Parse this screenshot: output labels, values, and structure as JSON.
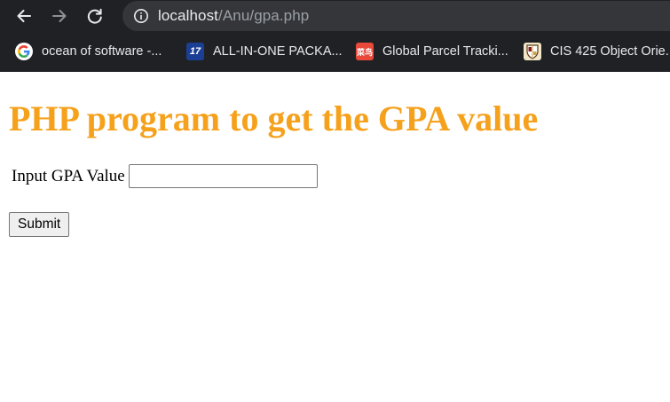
{
  "browser": {
    "url_host": "localhost",
    "url_path": "/Anu/gpa.php",
    "icons": {
      "back": "arrow-left-icon",
      "forward": "arrow-right-icon",
      "reload": "reload-icon",
      "site_info": "info-icon"
    },
    "bookmarks": [
      {
        "label": "ocean of software -...",
        "icon": "google-icon"
      },
      {
        "label": "ALL-IN-ONE PACKA...",
        "icon": "17track-icon",
        "icon_text": "17"
      },
      {
        "label": "Global Parcel Tracki...",
        "icon": "cainiao-icon",
        "icon_text": "菜鸟"
      },
      {
        "label": "CIS 425 Object Orie...",
        "icon": "shield-icon"
      }
    ]
  },
  "page": {
    "heading": "PHP program to get the GPA value",
    "heading_color": "#f6a11c",
    "form": {
      "label": "Input GPA Value",
      "input_value": "",
      "submit_label": "Submit"
    }
  }
}
